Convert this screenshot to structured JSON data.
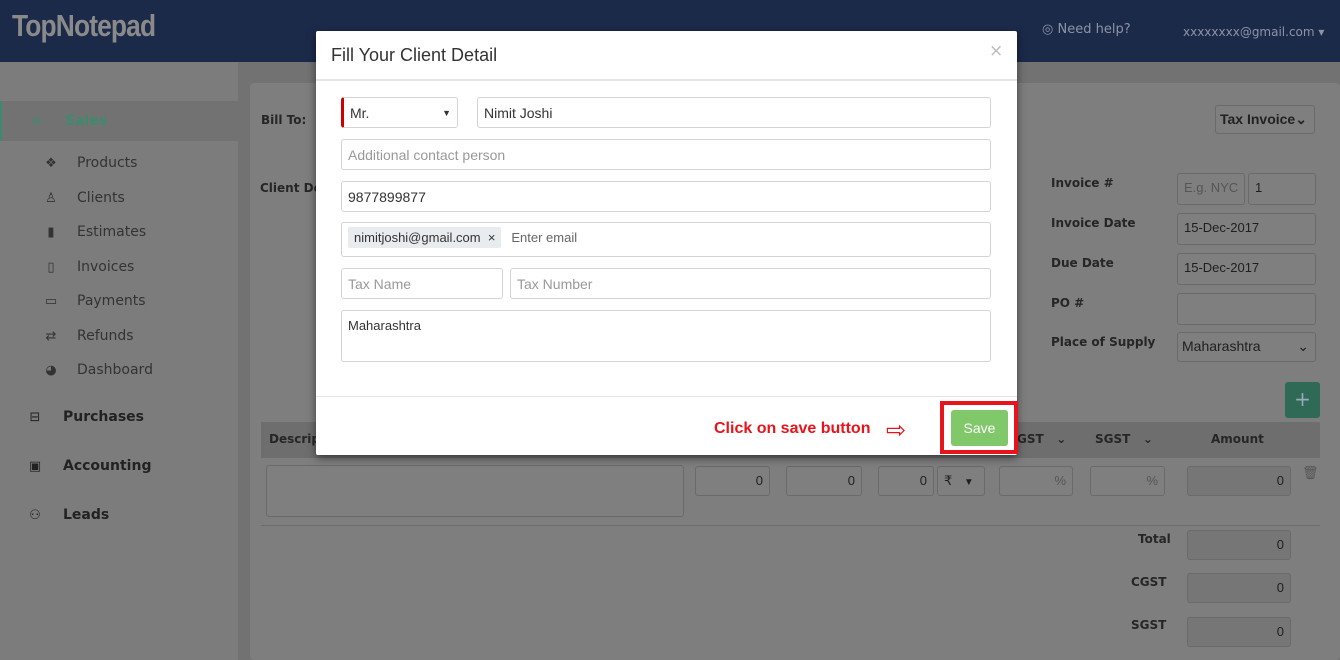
{
  "header": {
    "logo": "TopNotepad",
    "help": "Need help?",
    "user_email": "xxxxxxxx@gmail.com"
  },
  "sidebar": {
    "sales": "Sales",
    "items": [
      {
        "label": "Products",
        "icon": "cubes-icon"
      },
      {
        "label": "Clients",
        "icon": "user-icon"
      },
      {
        "label": "Estimates",
        "icon": "file-icon"
      },
      {
        "label": "Invoices",
        "icon": "file-outline-icon"
      },
      {
        "label": "Payments",
        "icon": "credit-card-icon"
      },
      {
        "label": "Refunds",
        "icon": "exchange-icon"
      },
      {
        "label": "Dashboard",
        "icon": "dashboard-icon"
      }
    ],
    "purchases": "Purchases",
    "accounting": "Accounting",
    "leads": "Leads",
    "accent": "#3e8a6e"
  },
  "invoice": {
    "bill_to": "Bill To:",
    "client_details": "Client De",
    "type": "Tax Invoice",
    "invoice_no_label": "Invoice #",
    "invoice_prefix_placeholder": "E.g. NYC",
    "invoice_no": "1",
    "invoice_date_label": "Invoice Date",
    "invoice_date": "15-Dec-2017",
    "due_date_label": "Due Date",
    "due_date": "15-Dec-2017",
    "po_label": "PO #",
    "po": "",
    "place_label": "Place of Supply",
    "place": "Maharashtra",
    "add": "+"
  },
  "table": {
    "headers": {
      "description": "Descrip",
      "cgst": "GST",
      "sgst": "SGST",
      "amount": "Amount"
    },
    "row": {
      "qty": "0",
      "rate": "0",
      "discount": "0",
      "currency": "₹",
      "cgst_unit": "%",
      "sgst_unit": "%",
      "amount": "0"
    },
    "totals": [
      {
        "label": "Total",
        "value": "0"
      },
      {
        "label": "CGST",
        "value": "0"
      },
      {
        "label": "SGST",
        "value": "0"
      }
    ]
  },
  "modal": {
    "title": "Fill Your Client Detail",
    "close": "×",
    "salutation": "Mr.",
    "name": "Nimit Joshi",
    "contact_placeholder": "Additional contact person",
    "phone": "9877899877",
    "email_tag": "nimitjoshi@gmail.com",
    "email_placeholder": "Enter email",
    "tax_name_placeholder": "Tax Name",
    "tax_number_placeholder": "Tax Number",
    "address": "Maharashtra",
    "save": "Save"
  },
  "annotation": {
    "text": "Click on save button",
    "color": "#e8141c"
  },
  "colors": {
    "save": "#80c86a",
    "header": "#1c2a4a"
  }
}
